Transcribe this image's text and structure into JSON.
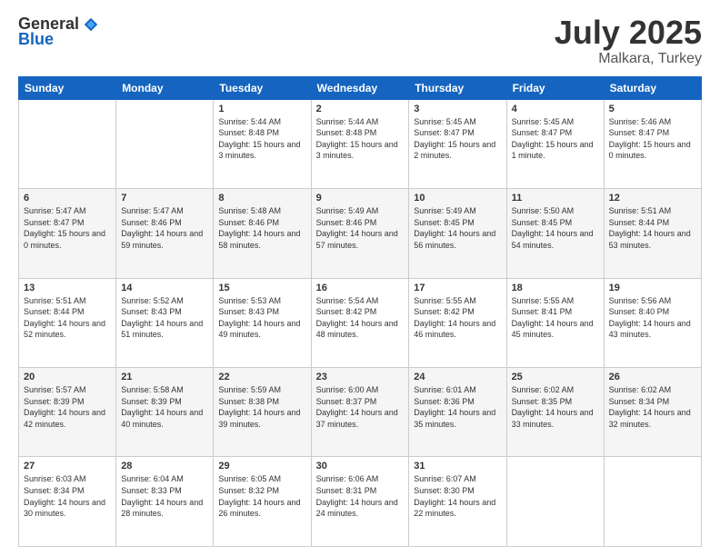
{
  "logo": {
    "general": "General",
    "blue": "Blue"
  },
  "title": {
    "month": "July 2025",
    "location": "Malkara, Turkey"
  },
  "headers": [
    "Sunday",
    "Monday",
    "Tuesday",
    "Wednesday",
    "Thursday",
    "Friday",
    "Saturday"
  ],
  "weeks": [
    [
      {
        "day": "",
        "info": ""
      },
      {
        "day": "",
        "info": ""
      },
      {
        "day": "1",
        "info": "Sunrise: 5:44 AM\nSunset: 8:48 PM\nDaylight: 15 hours and 3 minutes."
      },
      {
        "day": "2",
        "info": "Sunrise: 5:44 AM\nSunset: 8:48 PM\nDaylight: 15 hours and 3 minutes."
      },
      {
        "day": "3",
        "info": "Sunrise: 5:45 AM\nSunset: 8:47 PM\nDaylight: 15 hours and 2 minutes."
      },
      {
        "day": "4",
        "info": "Sunrise: 5:45 AM\nSunset: 8:47 PM\nDaylight: 15 hours and 1 minute."
      },
      {
        "day": "5",
        "info": "Sunrise: 5:46 AM\nSunset: 8:47 PM\nDaylight: 15 hours and 0 minutes."
      }
    ],
    [
      {
        "day": "6",
        "info": "Sunrise: 5:47 AM\nSunset: 8:47 PM\nDaylight: 15 hours and 0 minutes."
      },
      {
        "day": "7",
        "info": "Sunrise: 5:47 AM\nSunset: 8:46 PM\nDaylight: 14 hours and 59 minutes."
      },
      {
        "day": "8",
        "info": "Sunrise: 5:48 AM\nSunset: 8:46 PM\nDaylight: 14 hours and 58 minutes."
      },
      {
        "day": "9",
        "info": "Sunrise: 5:49 AM\nSunset: 8:46 PM\nDaylight: 14 hours and 57 minutes."
      },
      {
        "day": "10",
        "info": "Sunrise: 5:49 AM\nSunset: 8:45 PM\nDaylight: 14 hours and 56 minutes."
      },
      {
        "day": "11",
        "info": "Sunrise: 5:50 AM\nSunset: 8:45 PM\nDaylight: 14 hours and 54 minutes."
      },
      {
        "day": "12",
        "info": "Sunrise: 5:51 AM\nSunset: 8:44 PM\nDaylight: 14 hours and 53 minutes."
      }
    ],
    [
      {
        "day": "13",
        "info": "Sunrise: 5:51 AM\nSunset: 8:44 PM\nDaylight: 14 hours and 52 minutes."
      },
      {
        "day": "14",
        "info": "Sunrise: 5:52 AM\nSunset: 8:43 PM\nDaylight: 14 hours and 51 minutes."
      },
      {
        "day": "15",
        "info": "Sunrise: 5:53 AM\nSunset: 8:43 PM\nDaylight: 14 hours and 49 minutes."
      },
      {
        "day": "16",
        "info": "Sunrise: 5:54 AM\nSunset: 8:42 PM\nDaylight: 14 hours and 48 minutes."
      },
      {
        "day": "17",
        "info": "Sunrise: 5:55 AM\nSunset: 8:42 PM\nDaylight: 14 hours and 46 minutes."
      },
      {
        "day": "18",
        "info": "Sunrise: 5:55 AM\nSunset: 8:41 PM\nDaylight: 14 hours and 45 minutes."
      },
      {
        "day": "19",
        "info": "Sunrise: 5:56 AM\nSunset: 8:40 PM\nDaylight: 14 hours and 43 minutes."
      }
    ],
    [
      {
        "day": "20",
        "info": "Sunrise: 5:57 AM\nSunset: 8:39 PM\nDaylight: 14 hours and 42 minutes."
      },
      {
        "day": "21",
        "info": "Sunrise: 5:58 AM\nSunset: 8:39 PM\nDaylight: 14 hours and 40 minutes."
      },
      {
        "day": "22",
        "info": "Sunrise: 5:59 AM\nSunset: 8:38 PM\nDaylight: 14 hours and 39 minutes."
      },
      {
        "day": "23",
        "info": "Sunrise: 6:00 AM\nSunset: 8:37 PM\nDaylight: 14 hours and 37 minutes."
      },
      {
        "day": "24",
        "info": "Sunrise: 6:01 AM\nSunset: 8:36 PM\nDaylight: 14 hours and 35 minutes."
      },
      {
        "day": "25",
        "info": "Sunrise: 6:02 AM\nSunset: 8:35 PM\nDaylight: 14 hours and 33 minutes."
      },
      {
        "day": "26",
        "info": "Sunrise: 6:02 AM\nSunset: 8:34 PM\nDaylight: 14 hours and 32 minutes."
      }
    ],
    [
      {
        "day": "27",
        "info": "Sunrise: 6:03 AM\nSunset: 8:34 PM\nDaylight: 14 hours and 30 minutes."
      },
      {
        "day": "28",
        "info": "Sunrise: 6:04 AM\nSunset: 8:33 PM\nDaylight: 14 hours and 28 minutes."
      },
      {
        "day": "29",
        "info": "Sunrise: 6:05 AM\nSunset: 8:32 PM\nDaylight: 14 hours and 26 minutes."
      },
      {
        "day": "30",
        "info": "Sunrise: 6:06 AM\nSunset: 8:31 PM\nDaylight: 14 hours and 24 minutes."
      },
      {
        "day": "31",
        "info": "Sunrise: 6:07 AM\nSunset: 8:30 PM\nDaylight: 14 hours and 22 minutes."
      },
      {
        "day": "",
        "info": ""
      },
      {
        "day": "",
        "info": ""
      }
    ]
  ]
}
